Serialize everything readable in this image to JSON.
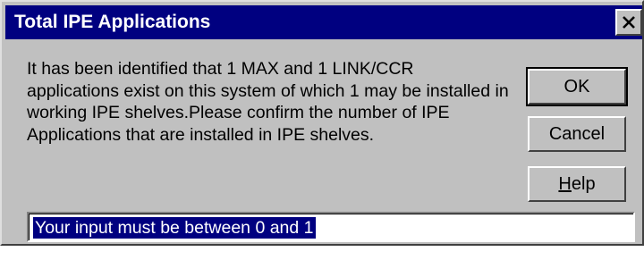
{
  "window": {
    "title": "Total IPE Applications",
    "close_icon": "close-x-icon"
  },
  "message": "It has been identified that 1 MAX and 1 LINK/CCR applications exist on this system of which 1 may be installed in working IPE shelves.Please confirm the number of IPE Applications that are installed in IPE shelves.",
  "buttons": {
    "ok_label": "OK",
    "cancel_label": "Cancel",
    "help_label": "Help"
  },
  "input": {
    "value": "Your input must be between 0 and 1",
    "selected": true
  },
  "colors": {
    "titlebar": "#000080",
    "face": "#c0c0c0",
    "selection": "#000080"
  }
}
